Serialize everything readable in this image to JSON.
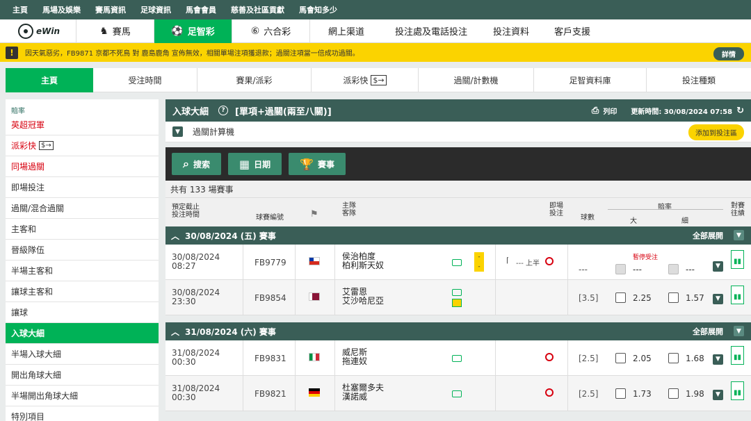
{
  "topbar": {
    "items": [
      "主頁",
      "馬場及娛樂",
      "賽馬資訊",
      "足球資訊",
      "馬會會員",
      "慈善及社區貢獻",
      "馬會知多少"
    ]
  },
  "mainnav": {
    "logo": "eWin",
    "items": [
      {
        "label": "賽馬",
        "icon": "horse-icon"
      },
      {
        "label": "足智彩",
        "icon": "football-icon"
      },
      {
        "label": "六合彩",
        "icon": "lottery-icon"
      }
    ],
    "links": [
      "網上渠道",
      "投注處及電話投注",
      "投注資料",
      "客戶支援"
    ]
  },
  "notice": {
    "text": "因天氣惡劣，FB9871 京都不死鳥 對 鹿島鹿角 宣佈無效，相關單場注項獲退款；過關注項當一倍成功過關。",
    "more": "詳情"
  },
  "subnav": [
    "主頁",
    "受注時間",
    "賽果/派彩",
    "派彩快",
    "過關/計數機",
    "足智資料庫",
    "投注種類"
  ],
  "sidebar": {
    "header": "賠率",
    "items": [
      "英超冠軍",
      "派彩快",
      "同場過關",
      "即場投注",
      "過關/混合過關",
      "主客和",
      "晉級隊伍",
      "半場主客和",
      "讓球主客和",
      "讓球",
      "入球大細",
      "半場入球大細",
      "開出角球大細",
      "半場開出角球大細",
      "特別項目"
    ]
  },
  "panel": {
    "title": "入球大細",
    "subtitle": "[單項+過關(兩至八關)]",
    "print": "列印",
    "updated": "更新時間: 30/08/2024 07:58",
    "calc": "過關計算機",
    "add": "添加到投注區",
    "buttons": [
      "搜索",
      "日期",
      "賽事"
    ],
    "count": "共有 133 場賽事",
    "headers": {
      "time1": "預定截止",
      "time2": "投注時間",
      "no": "球賽編號",
      "home": "主隊",
      "away": "客隊",
      "inplay1": "即場",
      "inplay2": "投注",
      "goals": "球數",
      "odds": "賠率",
      "high": "大",
      "low": "細",
      "h2h1": "對賽",
      "h2h2": "往績"
    }
  },
  "groups": [
    {
      "label": "30/08/2024 (五) 賽事",
      "expand": "全部展開",
      "rows": [
        {
          "date": "30/08/2024",
          "time": "08:27",
          "no": "FB9779",
          "home": "侯治柏度",
          "away": "柏利斯天奴",
          "live": "--- 上半",
          "goals": "---",
          "suspend": "暫停受注",
          "high": "---",
          "low": "---"
        },
        {
          "date": "30/08/2024",
          "time": "23:30",
          "no": "FB9854",
          "home": "艾雷恩",
          "away": "艾沙哈尼亞",
          "goals": "[3.5]",
          "high": "2.25",
          "low": "1.57"
        }
      ]
    },
    {
      "label": "31/08/2024 (六) 賽事",
      "expand": "全部展開",
      "rows": [
        {
          "date": "31/08/2024",
          "time": "00:30",
          "no": "FB9831",
          "home": "威尼斯",
          "away": "拖連奴",
          "goals": "[2.5]",
          "high": "2.05",
          "low": "1.68"
        },
        {
          "date": "31/08/2024",
          "time": "00:30",
          "no": "FB9821",
          "home": "杜塞爾多夫",
          "away": "漢諾威",
          "goals": "[2.5]",
          "high": "1.73",
          "low": "1.98"
        }
      ]
    }
  ],
  "colors": {
    "brand": "#3a5e57",
    "accent": "#00b257",
    "notice": "#fbd300",
    "alert": "#d7000f"
  }
}
